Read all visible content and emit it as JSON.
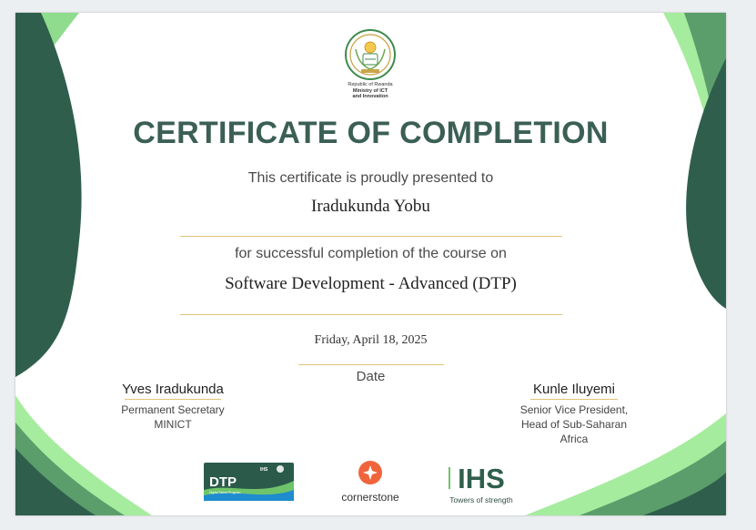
{
  "issuer": {
    "line1": "Republic of Rwanda",
    "line2": "Ministry of ICT",
    "line3": "and Innovation"
  },
  "certificate": {
    "title": "CERTIFICATE OF COMPLETION",
    "presented_text": "This certificate is proudly presented to",
    "recipient": "Iradukunda Yobu",
    "completion_text": "for successful completion of the course on",
    "course": "Software Development - Advanced (DTP)",
    "date": "Friday, April 18, 2025",
    "date_label": "Date"
  },
  "signatories": [
    {
      "name": "Yves Iradukunda",
      "role_line1": "Permanent Secretary",
      "role_line2": "MINICT",
      "role_line3": ""
    },
    {
      "name": "Kunle Iluyemi",
      "role_line1": "Senior Vice President,",
      "role_line2": "Head of Sub-Saharan",
      "role_line3": "Africa"
    }
  ],
  "logos": {
    "dtp": {
      "label": "DTP",
      "badge": "IHS",
      "subtitle": "Digital Talent Program"
    },
    "cornerstone": {
      "label": "cornerstone"
    },
    "ihs": {
      "label": "IHS",
      "tagline": "Towers of strength"
    }
  },
  "colors": {
    "dark_green": "#2f5f4c",
    "mid_green": "#5b9e6c",
    "light_green": "#9de59a",
    "title_color": "#3b5f55",
    "gold_line": "#e2c477",
    "cornerstone_orange": "#f0643c"
  }
}
